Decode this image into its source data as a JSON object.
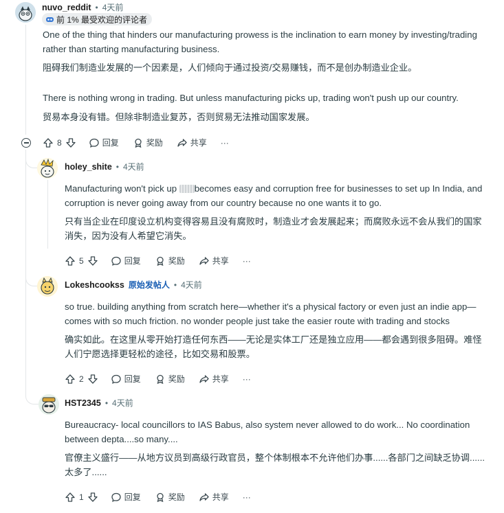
{
  "comments": [
    {
      "author": "nuvo_reddit",
      "time": "4天前",
      "flair": "前 1% 最受欢迎的评论者",
      "en_lines": [
        "One of the thing that hinders our manufacturing prowess is the inclination to earn money by investing/trading",
        "rather than starting manufacturing business."
      ],
      "zh_lines": [
        "阻碍我们制造业发展的一个因素是，人们倾向于通过投资/交易赚钱，而不是创办制造业企业。"
      ],
      "en2_lines": [
        "There is nothing wrong in trading. But unless manufacturing picks up, trading won't push up our country."
      ],
      "zh2_lines": [
        "贸易本身没有错。但除非制造业复苏，否则贸易无法推动国家发展。"
      ],
      "votes": "8"
    },
    {
      "author": "holey_shite",
      "time": "4天前",
      "en_line1_before": "Manufacturing won't pick up ",
      "en_line1_after": "becomes easy and corruption free for businesses to set up In India, and",
      "en_line2": "corruption is never going away from our country because no one wants it to go.",
      "zh_lines": [
        "只有当企业在印度设立机构变得容易且没有腐败时，制造业才会发展起来；而腐败永远不会从我们的国家",
        "消失，因为没有人希望它消失。"
      ],
      "votes": "5"
    },
    {
      "author": "Lokeshcookss",
      "op_badge": "原始发帖人",
      "time": "4天前",
      "en_lines": [
        "so true. building anything from scratch here—whether it's a physical factory or even just an indie app—",
        "comes with so much friction. no wonder people just take the easier route with trading and stocks"
      ],
      "zh_lines": [
        "确实如此。在这里从零开始打造任何东西——无论是实体工厂还是独立应用——都会遇到很多阻碍。难怪",
        "人们宁愿选择更轻松的途径，比如交易和股票。"
      ],
      "votes": "2"
    },
    {
      "author": "HST2345",
      "time": "4天前",
      "en_lines": [
        "Bureaucracy- local councillors to IAS Babus, also system never allowed to do work... No coordination",
        "between depta....so many...."
      ],
      "zh_lines": [
        "官僚主义盛行——从地方议员到高级行政官员，整个体制根本不允许他们办事......各部门之间缺乏协调......",
        "太多了......"
      ],
      "votes": "1"
    }
  ],
  "actions": {
    "reply": "回复",
    "award": "奖励",
    "share": "共享",
    "more": "···"
  },
  "dot": "•"
}
